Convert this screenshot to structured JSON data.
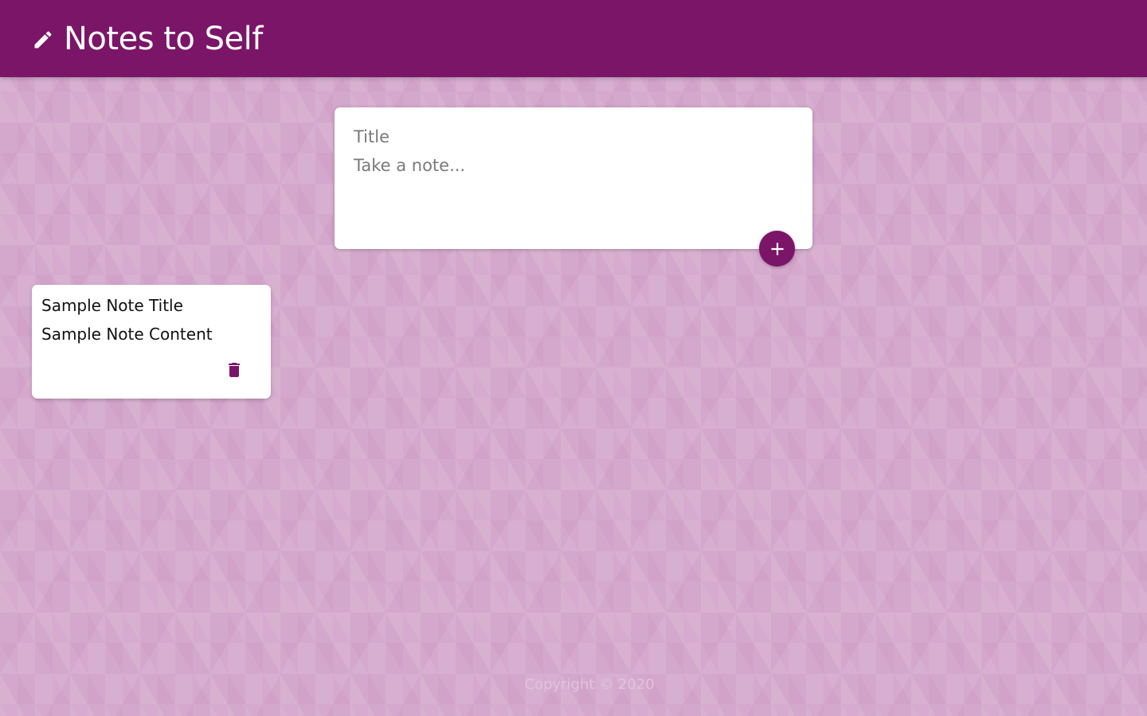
{
  "header": {
    "title": "Notes to Self",
    "icon": "pencil-icon",
    "background_color": "#7b1568"
  },
  "create_note": {
    "title_placeholder": "Title",
    "content_placeholder": "Take a note...",
    "add_button_icon": "plus-icon"
  },
  "notes": [
    {
      "title": "Sample Note Title",
      "content": "Sample Note Content",
      "delete_icon": "trash-icon"
    }
  ],
  "footer": {
    "text": "Copyright © 2020"
  },
  "colors": {
    "accent": "#7b1568",
    "background": "#d4a8cc",
    "card": "#ffffff"
  }
}
